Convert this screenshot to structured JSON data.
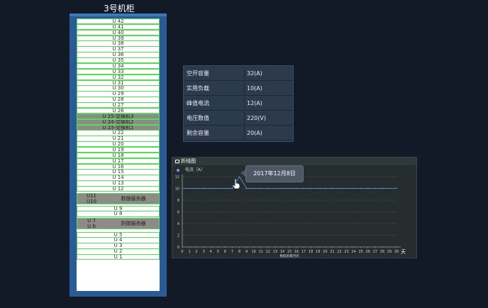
{
  "rack": {
    "title": "3号机柜",
    "slots": [
      {
        "label": "U 42"
      },
      {
        "label": "U 41"
      },
      {
        "label": "U 40"
      },
      {
        "label": "U 39"
      },
      {
        "label": "U 38"
      },
      {
        "label": "U 37"
      },
      {
        "label": "U 36"
      },
      {
        "label": "U 35"
      },
      {
        "label": "U 34"
      },
      {
        "label": "U 33"
      },
      {
        "label": "U 32"
      },
      {
        "label": "U 31"
      },
      {
        "label": "U 30"
      },
      {
        "label": "U 29"
      },
      {
        "label": "U 28"
      },
      {
        "label": "U 27"
      },
      {
        "label": "U 26"
      },
      {
        "label": "U 25-交换机3",
        "device": true
      },
      {
        "label": "U 24-交换机2",
        "device": true
      },
      {
        "label": "U 23-交换机1",
        "device": true
      },
      {
        "label": "U 22"
      },
      {
        "label": "U 21"
      },
      {
        "label": "U 20"
      },
      {
        "label": "U 19"
      },
      {
        "label": "U 18"
      },
      {
        "label": "U 17"
      },
      {
        "label": "U 16"
      },
      {
        "label": "U 15"
      },
      {
        "label": "U 14"
      },
      {
        "label": "U 13"
      },
      {
        "label": "U 12"
      }
    ],
    "device_blocks": [
      {
        "units": [
          "U11",
          "U10"
        ],
        "name": "数据服务器"
      },
      {
        "units": [
          "U 7",
          "U 6"
        ],
        "name": "防御服务器"
      }
    ],
    "slots_mid": [
      {
        "label": "U 9"
      },
      {
        "label": "U 8"
      }
    ],
    "slots_bottom": [
      {
        "label": "U 5"
      },
      {
        "label": "U 4"
      },
      {
        "label": "U 3"
      },
      {
        "label": "U 2"
      },
      {
        "label": "U 1"
      }
    ]
  },
  "info": {
    "rows": [
      {
        "label": "空开容量",
        "value": "32(A)"
      },
      {
        "label": "实用负载",
        "value": "10(A)"
      },
      {
        "label": "峰值电流",
        "value": "12(A)"
      },
      {
        "label": "电压数值",
        "value": "220(V)"
      },
      {
        "label": "剩余容量",
        "value": "20(A)"
      }
    ]
  },
  "chart_panel": {
    "title": "折线图",
    "legend": "电流（A）",
    "tooltip": "2017年12月8日",
    "x_unit": "天",
    "x_caption": "数据采集时间"
  },
  "chart_data": {
    "type": "line",
    "series": [
      {
        "name": "电流（A）",
        "values": [
          10,
          10,
          10,
          10,
          10,
          10,
          10,
          10,
          12,
          10,
          10,
          10,
          10,
          10,
          10,
          10,
          10,
          10,
          10,
          10,
          10,
          10,
          10,
          10,
          10,
          10,
          10,
          10,
          10,
          10,
          10
        ]
      }
    ],
    "x": [
      0,
      1,
      2,
      3,
      4,
      5,
      6,
      7,
      8,
      9,
      10,
      11,
      12,
      13,
      14,
      15,
      16,
      17,
      18,
      19,
      20,
      21,
      22,
      23,
      24,
      25,
      26,
      27,
      28,
      29,
      30
    ],
    "y_ticks": [
      0,
      2,
      4,
      6,
      8,
      10,
      12
    ],
    "ylim": [
      0,
      12
    ],
    "xlim": [
      0,
      30
    ],
    "grid": true,
    "colors": {
      "line": "#4a8ad8",
      "grid": "#5a6264",
      "axis": "#9aa2a4"
    }
  }
}
